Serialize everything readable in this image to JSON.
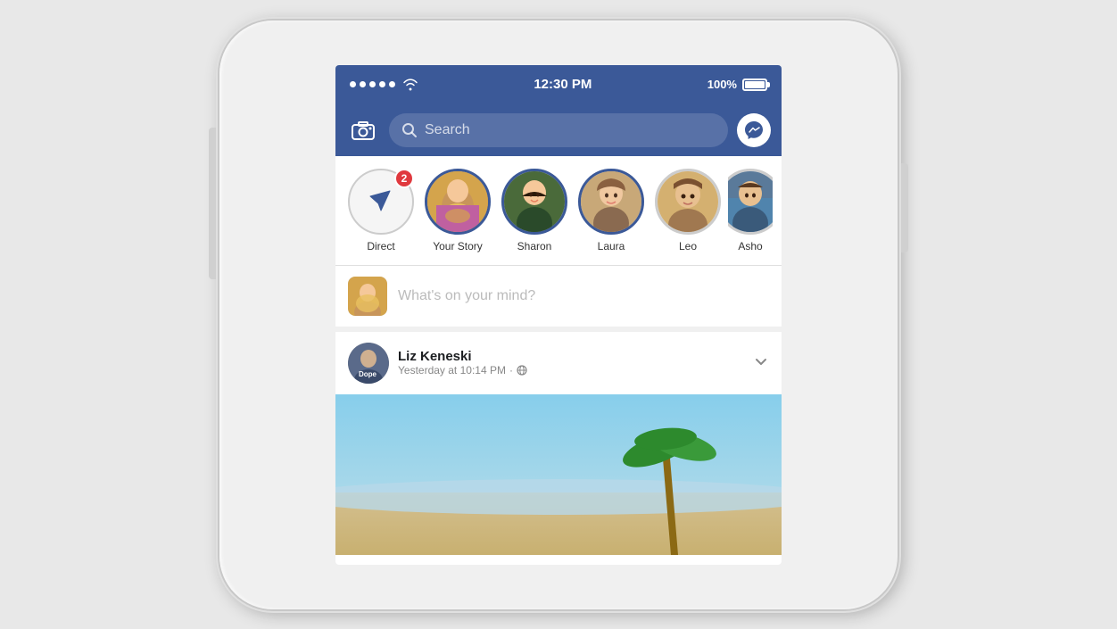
{
  "phone": {
    "status_bar": {
      "time": "12:30 PM",
      "battery_percent": "100%"
    },
    "header": {
      "search_placeholder": "Search",
      "search_icon": "search-icon",
      "camera_icon": "camera-icon",
      "messenger_icon": "messenger-icon"
    },
    "stories": {
      "items": [
        {
          "id": "direct",
          "label": "Direct",
          "badge": "2",
          "type": "direct"
        },
        {
          "id": "your-story",
          "label": "Your Story",
          "type": "story"
        },
        {
          "id": "sharon",
          "label": "Sharon",
          "type": "story"
        },
        {
          "id": "laura",
          "label": "Laura",
          "type": "story"
        },
        {
          "id": "leo",
          "label": "Leo",
          "type": "story"
        },
        {
          "id": "asho",
          "label": "Asho",
          "type": "story",
          "partial": true
        }
      ]
    },
    "composer": {
      "placeholder": "What's on your mind?"
    },
    "post": {
      "author": "Liz Keneski",
      "meta": "Yesterday at 10:14 PM · 🌐",
      "more_icon": "chevron-down-icon"
    }
  }
}
